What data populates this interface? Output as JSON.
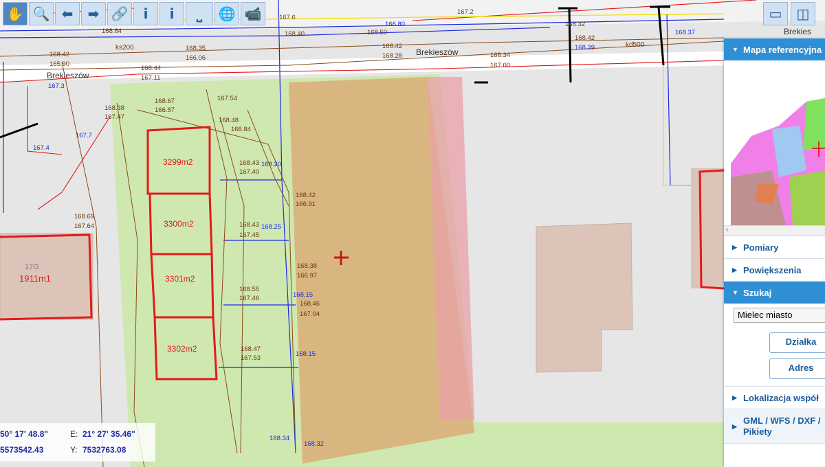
{
  "toolbar": {
    "tools": [
      {
        "name": "pan-tool",
        "glyph": "✋"
      },
      {
        "name": "zoom-tool",
        "glyph": "🔍"
      },
      {
        "name": "back-tool",
        "glyph": "⬅"
      },
      {
        "name": "forward-tool",
        "glyph": "➡"
      },
      {
        "name": "link-tool",
        "glyph": "🔗"
      },
      {
        "name": "info-tool",
        "glyph": "i"
      },
      {
        "name": "info-extended-tool",
        "glyph": "i"
      },
      {
        "name": "measure-tool",
        "glyph": "⎵"
      },
      {
        "name": "globe-tool",
        "glyph": "🌐"
      },
      {
        "name": "camera-tool",
        "glyph": "📹"
      }
    ]
  },
  "panel": {
    "ref_map_title": "Mapa referencyjna",
    "pomiary": "Pomiary",
    "powiekszenia": "Powiększenia",
    "szukaj": "Szukaj",
    "search_select_value": "Mielec miasto",
    "dzialka_button": "Działka",
    "adres_button": "Adres",
    "lokalizacja": "Lokalizacja współ",
    "gml_line1": "GML / WFS / DXF /",
    "gml_line2": "Pikiety"
  },
  "coords": {
    "lat": "50° 17' 48.8\"",
    "e_label": "E:",
    "lon": "21° 27' 35.46\"",
    "x_value": "5573542.43",
    "y_label": "Y:",
    "y_value": "7532763.08"
  },
  "map_labels": {
    "street1": "Brekieszów",
    "street2": "Brekieszów",
    "street3": "Brekies",
    "parcel_3299": "3299m2",
    "parcel_3300": "3300m2",
    "parcel_3301": "3301m2",
    "parcel_3302": "3302m2",
    "parcel_17g": "17G",
    "parcel_1911": "1911m1",
    "ks200": "ks200",
    "kd500": "kd500",
    "elev": [
      "168.84",
      "168.42",
      "165.90",
      "168.35",
      "166.06",
      "168.44",
      "167.11",
      "168.38",
      "167.47",
      "168.67",
      "166.87",
      "168.48",
      "166.84",
      "167.54",
      "168.43",
      "167.40",
      "168.42",
      "166.91",
      "168.43",
      "167.45",
      "168.38",
      "166.97",
      "168.55",
      "167.46",
      "168.46",
      "167.04",
      "168.47",
      "167.53",
      "168.69",
      "167.64",
      "167.6",
      "168.40",
      "168.50",
      "168.42",
      "168.28",
      "168.34",
      "167.00",
      "167.2",
      "168.32",
      "168.42",
      "168.39",
      "168.37",
      "168.20",
      "168.25",
      "168.15",
      "168.15",
      "168.34",
      "168.32",
      "167.3",
      "167.4",
      "167.7",
      "166.80"
    ]
  }
}
